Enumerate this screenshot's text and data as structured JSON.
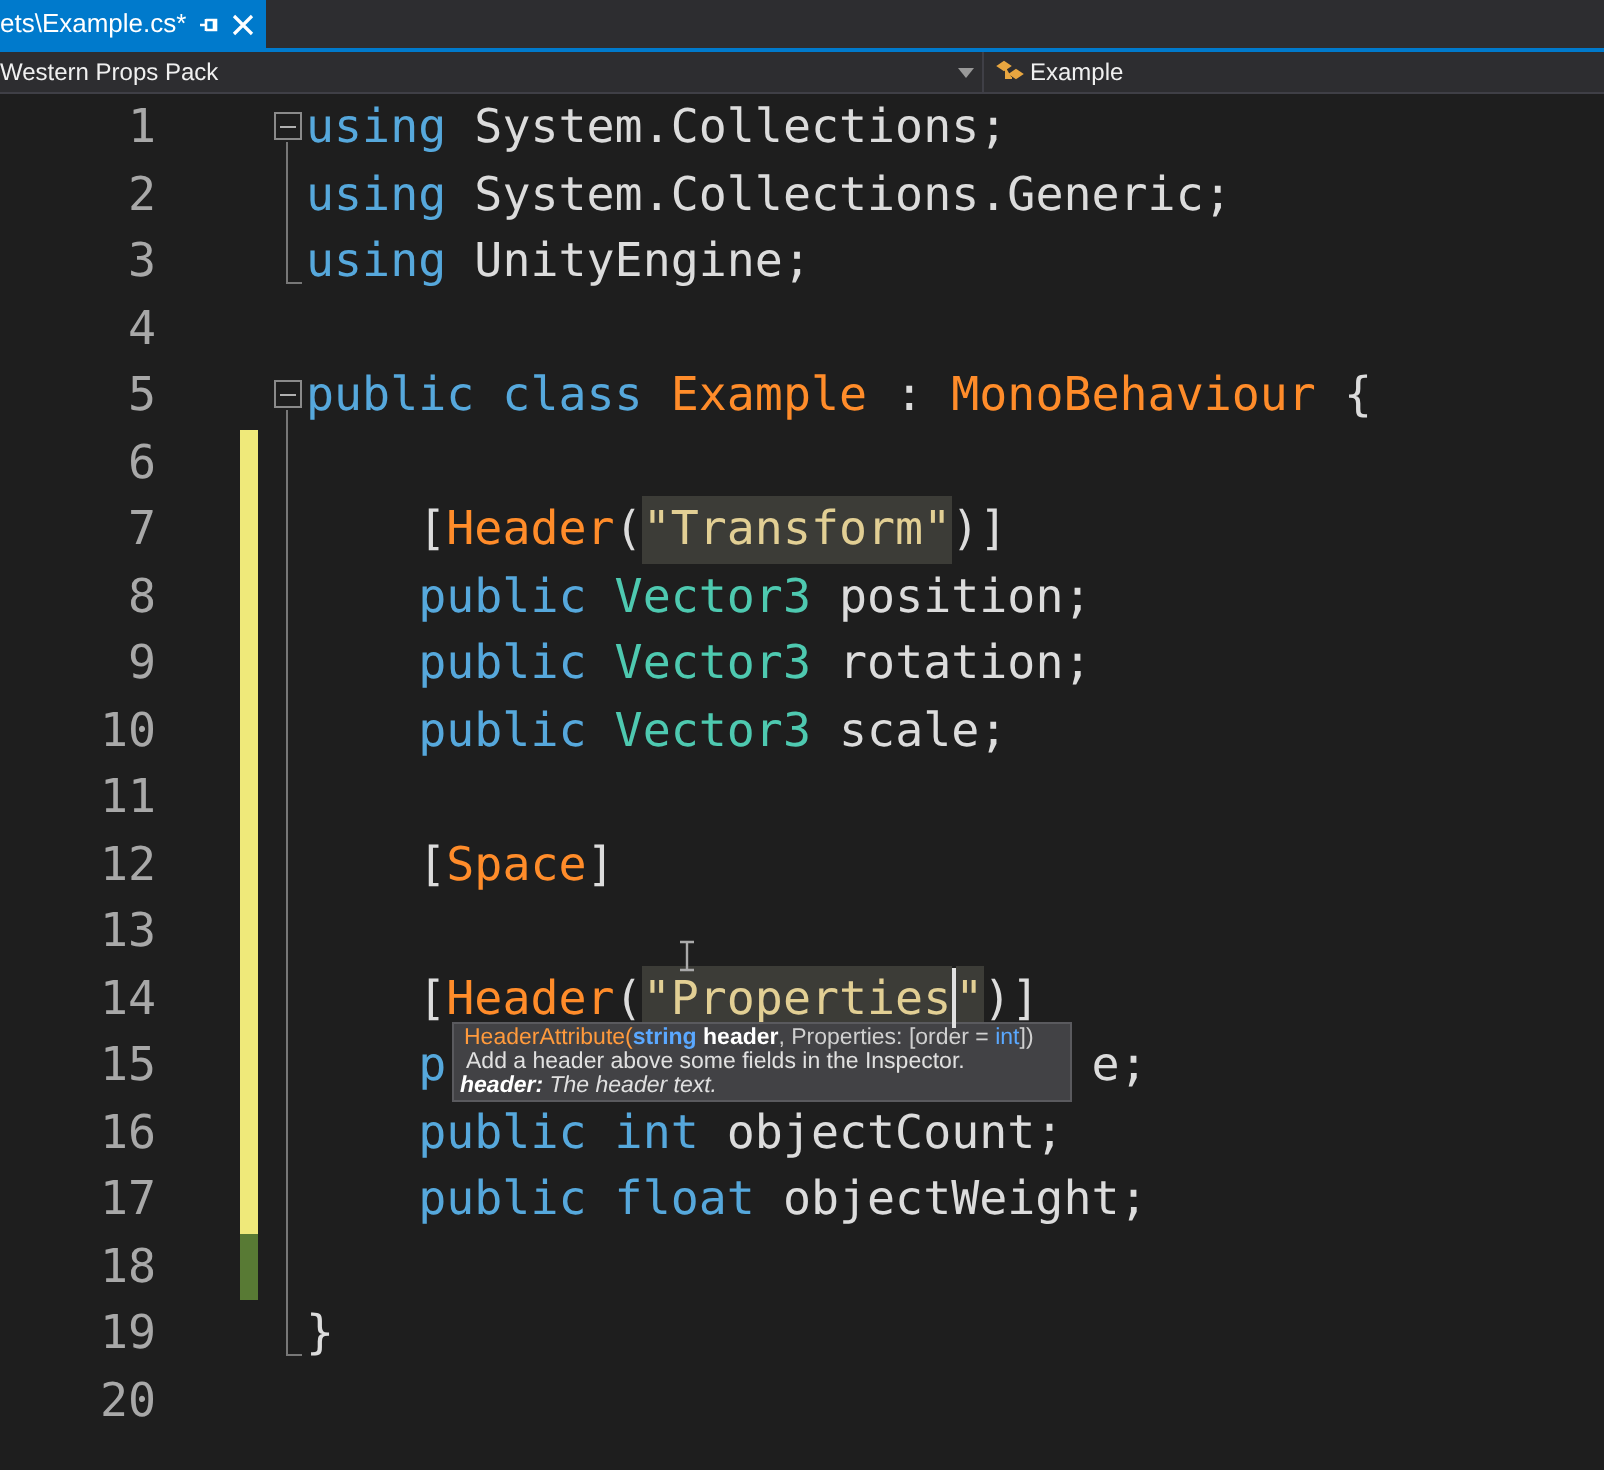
{
  "tab": {
    "title": "ets\\Example.cs*",
    "selected": true
  },
  "nav": {
    "project": "Western Props Pack",
    "class": "Example"
  },
  "lines": [
    {
      "number": "1",
      "modified": false,
      "saved": false,
      "tokens": [
        {
          "text": "using",
          "kind": "kw"
        },
        {
          "text": " System.Collections;",
          "kind": "plain"
        }
      ],
      "children": [
        {
          "number": "2",
          "modified": false,
          "saved": false,
          "tokens": [
            {
              "text": "using",
              "kind": "kw"
            },
            {
              "text": " System.Collections.Generic;",
              "kind": "plain"
            }
          ]
        },
        {
          "number": "3",
          "modified": false,
          "saved": false,
          "tokens": [
            {
              "text": "using",
              "kind": "kw"
            },
            {
              "text": " UnityEngine;",
              "kind": "plain"
            }
          ]
        }
      ]
    },
    {
      "number": "4",
      "modified": false,
      "saved": false
    },
    {
      "number": "5",
      "modified": false,
      "saved": false,
      "tokens": [
        {
          "text": "public class ",
          "kind": "kw"
        },
        {
          "text": "Example",
          "kind": "type"
        },
        {
          "text": " : ",
          "kind": "plain"
        },
        {
          "text": "MonoBehaviour",
          "kind": "type"
        },
        {
          "text": " {",
          "kind": "plain"
        }
      ],
      "children": [
        {
          "number": "6",
          "modified": true,
          "saved": false
        },
        {
          "number": "7",
          "modified": true,
          "saved": false,
          "tokens": [
            {
              "text": "    [",
              "kind": "plain"
            },
            {
              "text": "Header",
              "kind": "type"
            },
            {
              "text": "(",
              "kind": "plain"
            },
            {
              "text": "\"Transform\"",
              "kind": "string",
              "highlight": true
            },
            {
              "text": ")]",
              "kind": "plain"
            }
          ]
        },
        {
          "number": "8",
          "modified": true,
          "saved": false,
          "tokens": [
            {
              "text": "    public ",
              "kind": "kw"
            },
            {
              "text": "Vector3",
              "kind": "struct"
            },
            {
              "text": " position;",
              "kind": "plain"
            }
          ]
        },
        {
          "number": "9",
          "modified": true,
          "saved": false,
          "tokens": [
            {
              "text": "    public ",
              "kind": "kw"
            },
            {
              "text": "Vector3",
              "kind": "struct"
            },
            {
              "text": " rotation;",
              "kind": "plain"
            }
          ]
        },
        {
          "number": "10",
          "modified": true,
          "saved": false,
          "tokens": [
            {
              "text": "    public ",
              "kind": "kw"
            },
            {
              "text": "Vector3",
              "kind": "struct"
            },
            {
              "text": " scale;",
              "kind": "plain"
            }
          ]
        },
        {
          "number": "11",
          "modified": true,
          "saved": false
        },
        {
          "number": "12",
          "modified": true,
          "saved": false,
          "tokens": [
            {
              "text": "    [",
              "kind": "plain"
            },
            {
              "text": "Space",
              "kind": "type"
            },
            {
              "text": "]",
              "kind": "plain"
            }
          ]
        },
        {
          "number": "13",
          "modified": true,
          "saved": false
        },
        {
          "number": "14",
          "modified": true,
          "saved": false,
          "tokens": [
            {
              "text": "    [",
              "kind": "plain"
            },
            {
              "text": "Header",
              "kind": "type"
            },
            {
              "text": "(",
              "kind": "plain"
            },
            {
              "text": "\"Properties",
              "kind": "string",
              "highlight": true,
              "caret": true
            },
            {
              "text": "\"",
              "kind": "string",
              "highlight": true
            },
            {
              "text": ")]",
              "kind": "plain"
            }
          ]
        },
        {
          "number": "15",
          "modified": true,
          "saved": false,
          "tokens": [
            {
              "text": "    p",
              "kind": "kw"
            },
            {
              "text": "                       e;",
              "kind": "plain"
            }
          ]
        },
        {
          "number": "16",
          "modified": true,
          "saved": false,
          "tokens": [
            {
              "text": "    public int ",
              "kind": "kw"
            },
            {
              "text": "objectCount;",
              "kind": "plain"
            }
          ]
        },
        {
          "number": "17",
          "modified": true,
          "saved": false,
          "tokens": [
            {
              "text": "    public float ",
              "kind": "kw"
            },
            {
              "text": "objectWeight;",
              "kind": "plain"
            }
          ]
        },
        {
          "number": "18",
          "modified": false,
          "saved": true
        },
        {
          "number": "19",
          "modified": false,
          "saved": false,
          "tokens": [
            {
              "text": "}",
              "kind": "plain"
            }
          ]
        }
      ]
    },
    {
      "number": "20",
      "modified": false,
      "saved": false
    }
  ],
  "tooltip": {
    "signature": [
      {
        "text": "HeaderAttribute(",
        "kind": "type"
      },
      {
        "text": "string",
        "kind": "kwbold"
      },
      {
        "text": " header",
        "kind": "bold"
      },
      {
        "text": ", Properties: [order = ",
        "kind": "plain"
      },
      {
        "text": "int",
        "kind": "kw"
      },
      {
        "text": "])",
        "kind": "plain"
      }
    ],
    "description": "Add a header above some fields in the Inspector.",
    "param": [
      {
        "text": "header:",
        "kind": "bolditalic"
      },
      {
        "text": " The header text.",
        "kind": "italic"
      }
    ]
  }
}
